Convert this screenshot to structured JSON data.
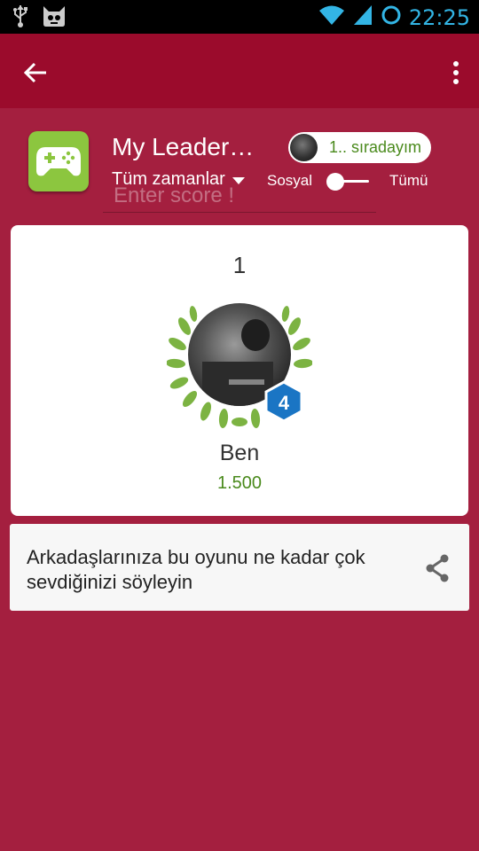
{
  "status_bar": {
    "time": "22:25",
    "icons": [
      "usb-icon",
      "cyanogen-mod-icon",
      "wifi-icon",
      "signal-icon",
      "sync-icon"
    ]
  },
  "app_bar": {
    "back_icon": "arrow-left-icon",
    "menu_icon": "more-vert-icon"
  },
  "header": {
    "title": "My Leader…",
    "rank_badge": "1.. sıradayım",
    "time_filter": "Tüm zamanlar",
    "score_input_placeholder": "Enter score !",
    "toggle_left": "Sosyal",
    "toggle_right": "Tümü"
  },
  "card": {
    "rank": "1",
    "level": "4",
    "player_name": "Ben",
    "score": "1.500"
  },
  "share": {
    "text": "Arkadaşlarınıza bu oyunu ne kadar çok sevdiğinizi söyleyin",
    "icon": "share-icon"
  },
  "colors": {
    "background": "#a41f3f",
    "app_bar": "#9b0b2c",
    "accent_green": "#4a8a1c",
    "level_badge": "#1a75c4",
    "clock": "#33b5e5"
  }
}
